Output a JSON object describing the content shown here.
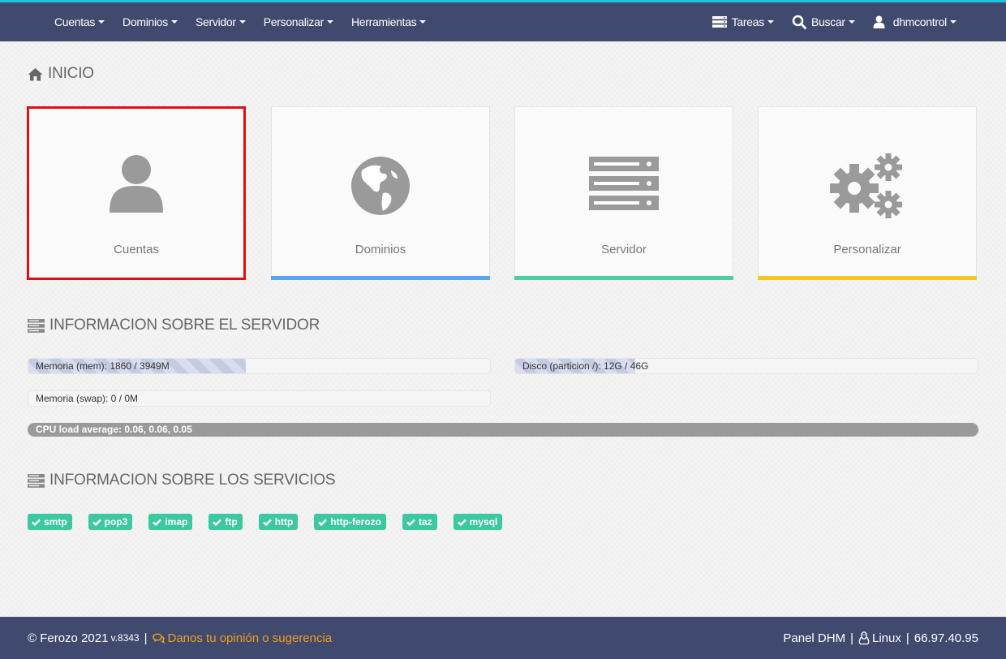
{
  "navbar": {
    "menus": [
      "Cuentas",
      "Dominios",
      "Servidor",
      "Personalizar",
      "Herramientas"
    ],
    "tasks_label": "Tareas",
    "search_label": "Buscar",
    "user_label": "dhmcontrol",
    "accent_color": "#1ec3e0",
    "background_color": "#3f4a6e"
  },
  "home": {
    "title": "INICIO",
    "cards": [
      {
        "label": "Cuentas",
        "icon": "user-icon",
        "bar_color": "#e01010",
        "selected": true
      },
      {
        "label": "Dominios",
        "icon": "globe-icon",
        "bar_color": "#57a6f2"
      },
      {
        "label": "Servidor",
        "icon": "server-icon",
        "bar_color": "#4ccfa1"
      },
      {
        "label": "Personalizar",
        "icon": "gears-icon",
        "bar_color": "#f5c81c"
      }
    ]
  },
  "server_info": {
    "title": "INFORMACION SOBRE EL SERVIDOR",
    "memory": {
      "label": "Memoria (mem): 1860 / 3949M",
      "fraction": 0.471
    },
    "disk": {
      "label": "Disco (particion /): 12G / 46G",
      "fraction": 0.26
    },
    "swap": {
      "label": "Memoria (swap): 0 / 0M",
      "fraction": 0
    },
    "cpu": {
      "label": "CPU load average: 0.06, 0.06, 0.05"
    }
  },
  "services_info": {
    "title": "INFORMACION SOBRE LOS SERVICIOS",
    "services": [
      "smtp",
      "pop3",
      "imap",
      "ftp",
      "http",
      "http-ferozo",
      "taz",
      "mysql"
    ],
    "status_color": "#3cc9a0"
  },
  "footer": {
    "copyright": "© Ferozo 2021",
    "version": "v.8343",
    "separator": "|",
    "feedback": "Danos tu opinión o sugerencia",
    "panel": "Panel DHM",
    "os": "Linux",
    "ip": "66.97.40.95"
  }
}
